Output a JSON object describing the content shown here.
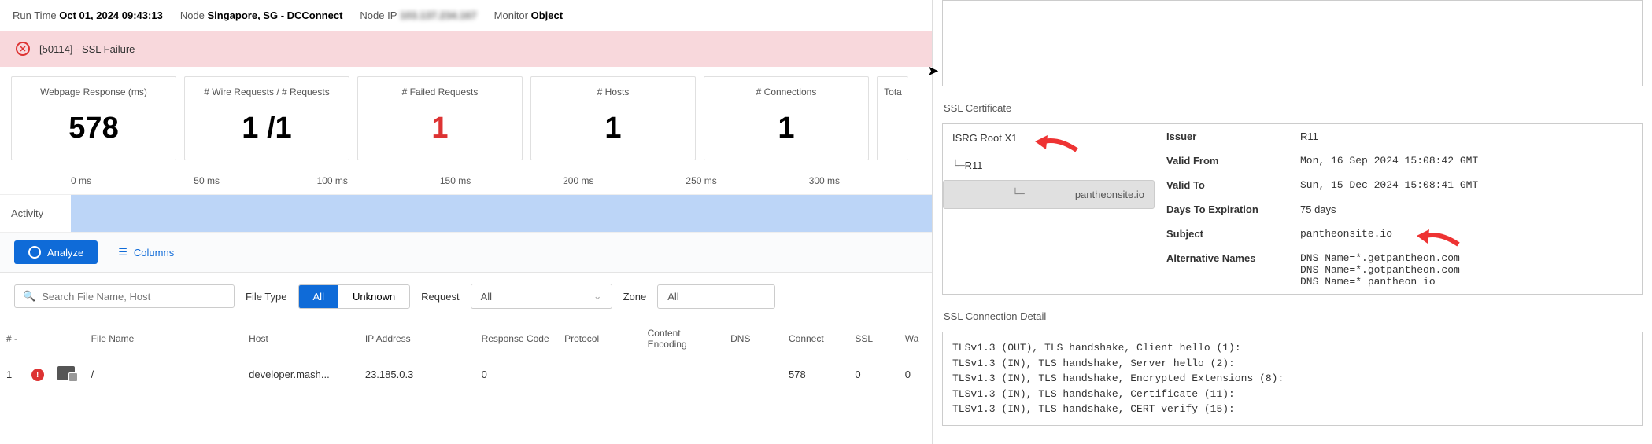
{
  "header": {
    "runtime_label": "Run Time",
    "runtime_value": "Oct 01, 2024 09:43:13",
    "node_label": "Node",
    "node_value": "Singapore, SG - DCConnect",
    "nodeip_label": "Node IP",
    "nodeip_value": "",
    "monitor_label": "Monitor",
    "monitor_value": "Object"
  },
  "banner": {
    "text": "[50114] - SSL Failure"
  },
  "metrics": [
    {
      "label": "Webpage Response (ms)",
      "value": "578",
      "red": false
    },
    {
      "label": "# Wire Requests / # Requests",
      "value": "1 /1",
      "red": false
    },
    {
      "label": "# Failed Requests",
      "value": "1",
      "red": true
    },
    {
      "label": "# Hosts",
      "value": "1",
      "red": false
    },
    {
      "label": "# Connections",
      "value": "1",
      "red": false
    },
    {
      "label": "Tota",
      "value": "",
      "red": false
    }
  ],
  "timeline": {
    "ticks": [
      "0 ms",
      "50 ms",
      "100 ms",
      "150 ms",
      "200 ms",
      "250 ms",
      "300 ms"
    ],
    "activity_label": "Activity"
  },
  "toolbar": {
    "analyze": "Analyze",
    "columns": "Columns"
  },
  "filters": {
    "search_placeholder": "Search File Name, Host",
    "filetype_label": "File Type",
    "filetype_options": [
      "All",
      "Unknown"
    ],
    "request_label": "Request",
    "request_value": "All",
    "zone_label": "Zone",
    "zone_value": "All"
  },
  "table": {
    "headers": [
      "# -",
      "",
      "",
      "File Name",
      "Host",
      "IP Address",
      "Response Code",
      "Protocol",
      "Content Encoding",
      "DNS",
      "Connect",
      "SSL",
      "Wa"
    ],
    "row": {
      "num": "1",
      "filename": "/",
      "host": "developer.mash...",
      "ip": "23.185.0.3",
      "respcode": "0",
      "protocol": "",
      "enc": "",
      "dns": "",
      "connect": "578",
      "ssl": "0",
      "wa": "0"
    }
  },
  "cert": {
    "title": "SSL Certificate",
    "tree": {
      "root": "ISRG Root X1",
      "inter": "R11",
      "leaf": "pantheonsite.io"
    },
    "details": {
      "issuer_k": "Issuer",
      "issuer_v": "R11",
      "validfrom_k": "Valid From",
      "validfrom_v": "Mon, 16 Sep 2024 15:08:42 GMT",
      "validto_k": "Valid To",
      "validto_v": "Sun, 15 Dec 2024 15:08:41 GMT",
      "days_k": "Days To Expiration",
      "days_v": "75 days",
      "subject_k": "Subject",
      "subject_v": "pantheonsite.io",
      "altnames_k": "Alternative Names",
      "altnames_v": "DNS Name=*.getpantheon.com\nDNS Name=*.gotpantheon.com\nDNS Name=* pantheon io"
    }
  },
  "conn": {
    "title": "SSL Connection Detail",
    "lines": "TLSv1.3 (OUT), TLS handshake, Client hello (1):\nTLSv1.3 (IN), TLS handshake, Server hello (2):\nTLSv1.3 (IN), TLS handshake, Encrypted Extensions (8):\nTLSv1.3 (IN), TLS handshake, Certificate (11):\nTLSv1.3 (IN), TLS handshake, CERT verify (15):"
  }
}
